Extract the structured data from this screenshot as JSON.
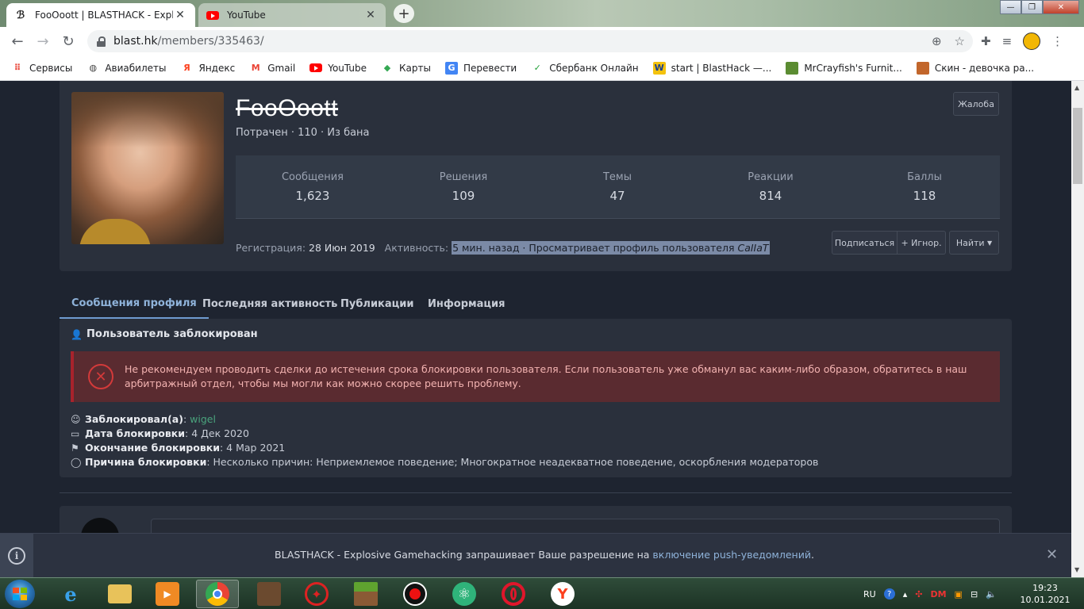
{
  "browser": {
    "tabs": [
      {
        "title": "FooOoott | BLASTHACK - Explosi",
        "active": true
      },
      {
        "title": "YouTube",
        "active": false
      }
    ],
    "url_host": "blast.hk",
    "url_path": "/members/335463/",
    "bookmarks": [
      {
        "label": "Сервисы",
        "icon": "apps-grid-icon"
      },
      {
        "label": "Авиабилеты",
        "icon": "globe-icon"
      },
      {
        "label": "Яндекс",
        "icon": "yandex-icon"
      },
      {
        "label": "Gmail",
        "icon": "gmail-icon"
      },
      {
        "label": "YouTube",
        "icon": "youtube-icon"
      },
      {
        "label": "Карты",
        "icon": "maps-icon"
      },
      {
        "label": "Перевести",
        "icon": "translate-icon"
      },
      {
        "label": "Сбербанк Онлайн",
        "icon": "sberbank-icon"
      },
      {
        "label": "start | BlastHack —...",
        "icon": "blasthack-icon"
      },
      {
        "label": "MrCrayfish's Furnit...",
        "icon": "minecraft-icon"
      },
      {
        "label": "Скин - девочка ра...",
        "icon": "skin-icon"
      }
    ]
  },
  "profile": {
    "username": "FooOoott",
    "meta": "Потрачен · 110 · Из бана",
    "report_label": "Жалоба",
    "stats": [
      {
        "label": "Сообщения",
        "value": "1,623"
      },
      {
        "label": "Решения",
        "value": "109"
      },
      {
        "label": "Темы",
        "value": "47"
      },
      {
        "label": "Реакции",
        "value": "814"
      },
      {
        "label": "Баллы",
        "value": "118"
      }
    ],
    "registration_label": "Регистрация:",
    "registration_value": "28 Июн 2019",
    "activity_label": "Активность:",
    "activity_value": "5 мин. назад · Просматривает профиль пользователя ",
    "activity_user": "CaIIaT",
    "buttons": {
      "follow": "Подписаться",
      "ignore": "+ Игнор.",
      "find": "Найти"
    }
  },
  "profile_tabs": [
    "Сообщения профиля",
    "Последняя активность",
    "Публикации",
    "Информация"
  ],
  "ban": {
    "title": "Пользователь заблокирован",
    "alert": "Не рекомендуем проводить сделки до истечения срока блокировки пользователя. Если пользователь уже обманул вас каким-либо образом, обратитесь в наш арбитражный отдел, чтобы мы могли как можно скорее решить проблему.",
    "blocked_by_label": "Заблокировал(а)",
    "blocked_by_value": "wigel",
    "date_label": "Дата блокировки",
    "date_value": "4 Дек 2020",
    "end_label": "Окончание блокировки",
    "end_value": "4 Мар 2021",
    "reason_label": "Причина блокировки",
    "reason_value": "Несколько причин: Неприемлемое поведение; Многократное неадекватное поведение, оскорбления модераторов"
  },
  "push": {
    "text": "BLASTHACK - Explosive Gamehacking запрашивает Ваше разрешение на ",
    "link": "включение push-уведомлений",
    "end": "."
  },
  "taskbar": {
    "lang": "RU",
    "time": "19:23",
    "date": "10.01.2021",
    "apps": [
      "ie-icon",
      "explorer-icon",
      "media-player-icon",
      "chrome-icon",
      "gta-icon",
      "radiant-icon",
      "minecraft-icon",
      "obs-icon",
      "atom-icon",
      "opera-icon",
      "yandex-icon"
    ]
  },
  "colors": {
    "accent": "#6f9bd0",
    "alert_bg": "#5a2b30",
    "alert_border": "#a8232c",
    "link_green": "#4aa37d"
  }
}
